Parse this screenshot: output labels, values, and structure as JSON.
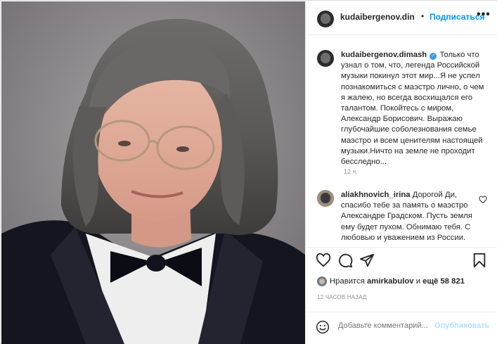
{
  "post": {
    "photo_alt": "photo",
    "header": {
      "username": "kudaibergenov.din",
      "separator": "•",
      "follow_label": "Подписаться",
      "more_icon": "more-horizontal-icon"
    },
    "caption": {
      "author": "kudaibergenov.dimash",
      "verified_icon": "verified-badge-icon",
      "text": "Только что узнал о том, что, легенда Российской музыки покинул этот мир...Я не успел познакомиться с маэстро лично, о чем я жалею, но всегда восхищался его талантом. Покойтесь с миром, Александр Борисович. Выражаю глубочайшие соболезнования семье маэстро и всем ценителям настоящей музыки.Ничто на земле не проходит бесследно...",
      "time": "12 ч."
    },
    "comments": [
      {
        "author": "aliakhnovich_irina",
        "text": "Дорогой Ди, спасибо тебе за память о маэстро Александре Градском. Пусть земля ему будет пухом. Обнимаю тебя. С любовью и уважением из России."
      }
    ],
    "actions": {
      "like_icon": "heart-icon",
      "comment_icon": "comment-icon",
      "share_icon": "share-icon",
      "save_icon": "bookmark-icon"
    },
    "likes": {
      "prefix": "Нравится",
      "user": "amirkabulov",
      "middle": "и",
      "count_text": "ещё 58 821"
    },
    "timestamp": "12 ЧАСОВ НАЗАД",
    "add_comment": {
      "placeholder": "Добавьте комментарий...",
      "post_label": "Опубликовать",
      "emoji_icon": "emoji-icon"
    }
  },
  "colors": {
    "accent": "#0095f6",
    "post_disabled": "#b2dffc",
    "muted": "#8e8e8e",
    "text": "#262626",
    "border": "#efefef"
  }
}
